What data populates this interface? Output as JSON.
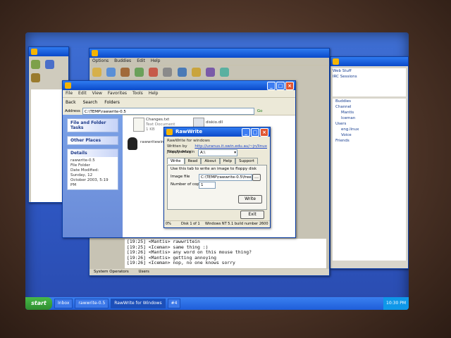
{
  "taskbar": {
    "start_label": "start",
    "items": [
      "Inbox",
      "rawwrite-0.5",
      "RawWrite for Windows",
      "#4"
    ],
    "clock": "10:30 PM"
  },
  "chat_window": {
    "menu": [
      "Options",
      "Buddies",
      "Edit",
      "Help"
    ],
    "lines": [
      "[19:25] <Mantis> rawwritein",
      "[19:25] <Iceman> same thing :)",
      "[19:26] <Mantis> any word on this mouse thing?",
      "[19:26] <Mantis> getting annoying",
      "[19:26] <Iceman> nop, no one knows sorry"
    ],
    "status_items": [
      "System Operators",
      "Users"
    ]
  },
  "explorer": {
    "menu": [
      "File",
      "Edit",
      "View",
      "Favorites",
      "Tools",
      "Help"
    ],
    "toolbar": {
      "back": "Back",
      "search": "Search",
      "folders": "Folders"
    },
    "address_label": "Address",
    "address_value": "C:\\TEMP\\rawwrite-0.5",
    "go": "Go",
    "tasks_panel": "File and Folder Tasks",
    "places_panel": "Other Places",
    "details_panel": "Details",
    "details_lines": [
      "rawwrite-0.5",
      "File Folder",
      "Date Modified: Sunday, 12",
      "October 2003, 5:19 PM"
    ],
    "files": [
      {
        "name": "Changes.txt",
        "desc": "Text Document",
        "size": "1 KB"
      },
      {
        "name": "diskio.dll",
        "desc": "",
        "size": ""
      },
      {
        "name": "rawwritewin.exe",
        "desc": "",
        "size": ""
      }
    ]
  },
  "rawwrite": {
    "title": "RawWrite",
    "line1": "RawWrite for windows",
    "line2": "Written by John Newbigin",
    "url": "http://uranus.it.swin.edu.au/~jn/linux",
    "floppy_label": "Floppy drive",
    "floppy_value": "A:\\",
    "tabs": [
      "Write",
      "Read",
      "About",
      "Help",
      "Support"
    ],
    "instructions": "Use this tab to write an image to floppy disk",
    "image_label": "Image file",
    "image_value": "C:\\TEMP\\rawwrite-0.5\\freesco.bin",
    "copies_label": "Number of copies",
    "copies_value": "1",
    "write_button": "Write",
    "exit_button": "Exit",
    "status": [
      "0%",
      "Disk 1 of 1",
      "Windows NT 5.1 build number 2600"
    ]
  },
  "buddy_list": {
    "tree": [
      "Web Stuff",
      "IRC Sessions",
      "Buddies",
      "Channel",
      "Mantis",
      "Iceman",
      "Users",
      "eng.linux",
      "Voice",
      "Friends"
    ]
  }
}
